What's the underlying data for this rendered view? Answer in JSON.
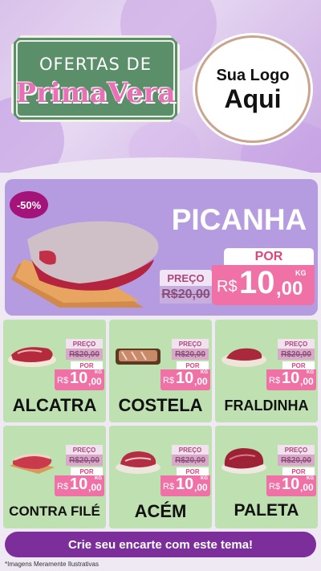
{
  "header": {
    "title_top": "OFERTAS DE",
    "title_main": "PrimaVera",
    "logo_line1": "Sua Logo",
    "logo_line2": "Aqui"
  },
  "feature": {
    "discount": "-50%",
    "name": "PICANHA",
    "preco_label": "PREÇO",
    "old_price": "R$20,00",
    "por_label": "POR",
    "currency": "R$",
    "price_int": "10",
    "price_dec": ",00",
    "unit": "KG"
  },
  "items": [
    {
      "name": "ALCATRA",
      "preco_label": "PREÇO",
      "old_price": "R$20,00",
      "por_label": "POR",
      "currency": "R$",
      "price_int": "10",
      "price_dec": ",00",
      "unit": "KG"
    },
    {
      "name": "COSTELA",
      "preco_label": "PREÇO",
      "old_price": "R$20,00",
      "por_label": "POR",
      "currency": "R$",
      "price_int": "10",
      "price_dec": ",00",
      "unit": "KG"
    },
    {
      "name": "FRALDINHA",
      "preco_label": "PREÇO",
      "old_price": "R$20,00",
      "por_label": "POR",
      "currency": "R$",
      "price_int": "10",
      "price_dec": ",00",
      "unit": "KG"
    },
    {
      "name": "CONTRA FILÉ",
      "preco_label": "PREÇO",
      "old_price": "R$20,00",
      "por_label": "POR",
      "currency": "R$",
      "price_int": "10",
      "price_dec": ",00",
      "unit": "KG"
    },
    {
      "name": "ACÉM",
      "preco_label": "PREÇO",
      "old_price": "R$20,00",
      "por_label": "POR",
      "currency": "R$",
      "price_int": "10",
      "price_dec": ",00",
      "unit": "KG"
    },
    {
      "name": "PALETA",
      "preco_label": "PREÇO",
      "old_price": "R$20,00",
      "por_label": "POR",
      "currency": "R$",
      "price_int": "10",
      "price_dec": ",00",
      "unit": "KG"
    }
  ],
  "footer": {
    "cta": "Crie seu encarte com este tema!",
    "disclaimer": "*Imagens Meramente Ilustrativas"
  },
  "colors": {
    "accent_pink": "#ef71a6",
    "purple": "#7c2f9b",
    "green_panel": "#bfe0b0",
    "lilac_panel": "#b59be0"
  }
}
